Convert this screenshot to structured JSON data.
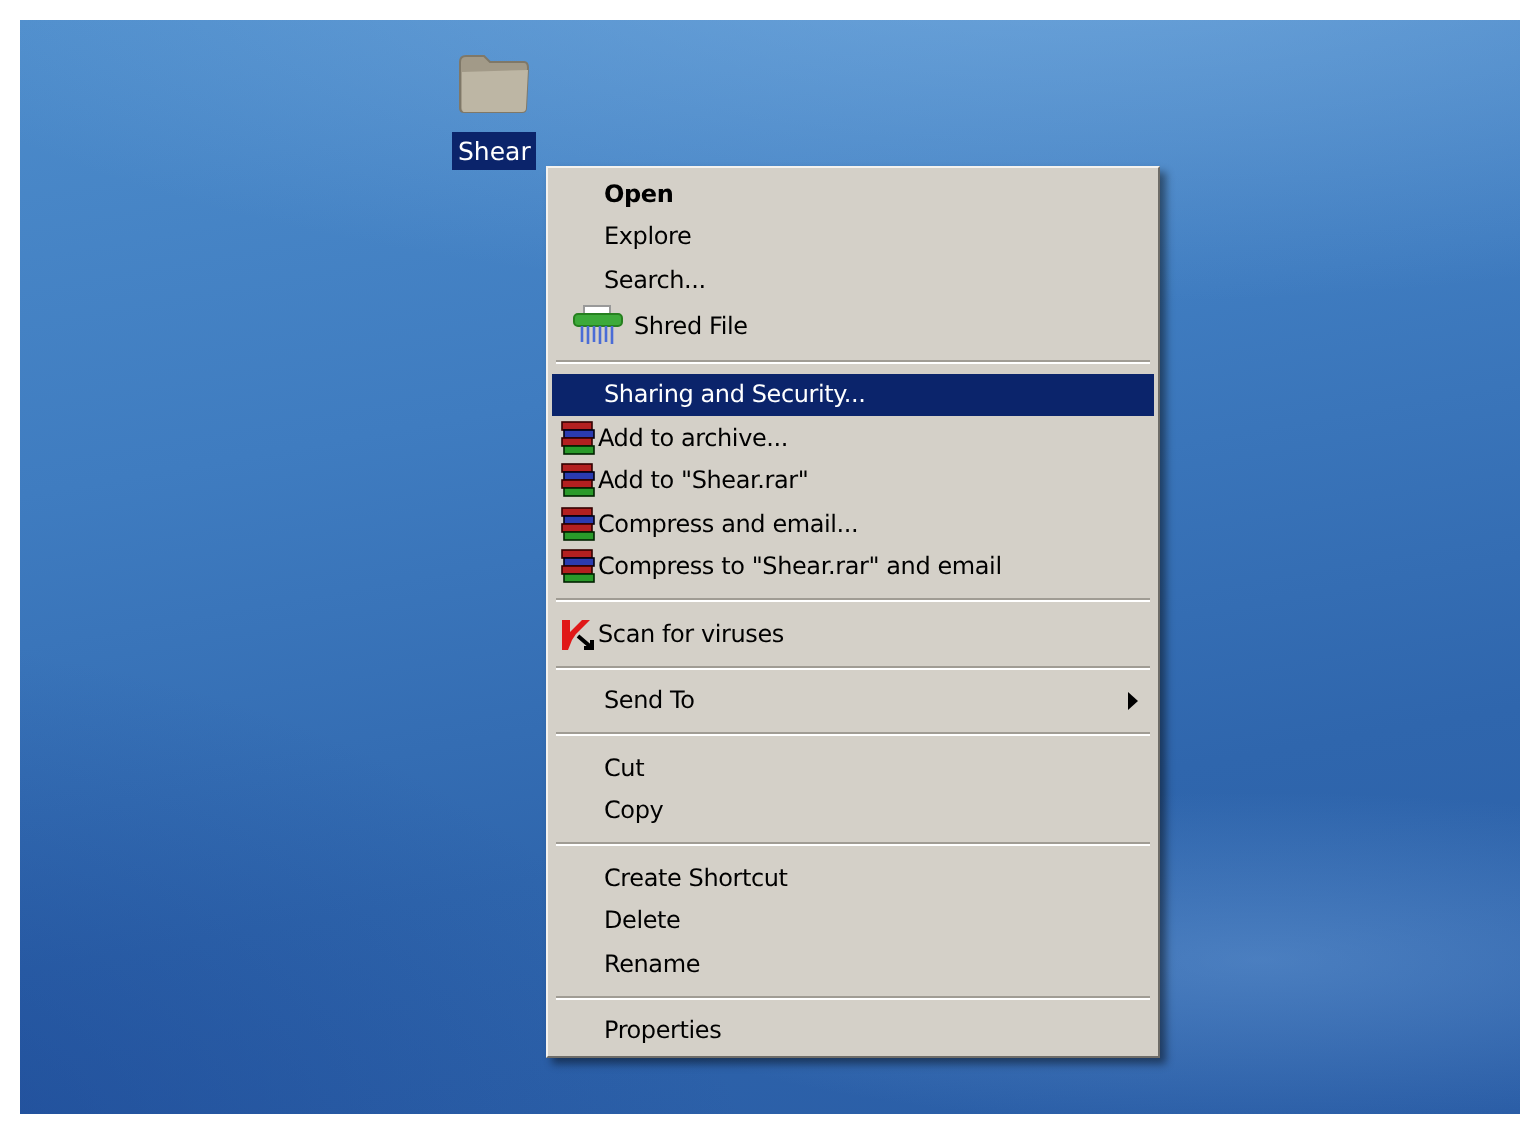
{
  "desktop": {
    "icons": [
      {
        "label": "Shear",
        "selected": true
      }
    ]
  },
  "context_menu": {
    "items": [
      {
        "kind": "item",
        "label": "Open",
        "default": true,
        "selected": false,
        "submenu": false
      },
      {
        "kind": "item",
        "label": "Explore",
        "default": false,
        "selected": false,
        "submenu": false
      },
      {
        "kind": "item",
        "label": "Search...",
        "default": false,
        "selected": false,
        "submenu": false
      },
      {
        "kind": "shred",
        "label": "Shred File",
        "default": false,
        "selected": false,
        "submenu": false
      },
      {
        "kind": "separator"
      },
      {
        "kind": "item",
        "label": "Sharing and Security...",
        "default": false,
        "selected": true,
        "submenu": false
      },
      {
        "kind": "archive",
        "label": "Add to archive...",
        "default": false,
        "selected": false,
        "submenu": false
      },
      {
        "kind": "archive",
        "label": "Add to \"Shear.rar\"",
        "default": false,
        "selected": false,
        "submenu": false
      },
      {
        "kind": "archive",
        "label": "Compress and email...",
        "default": false,
        "selected": false,
        "submenu": false
      },
      {
        "kind": "archive",
        "label": "Compress to \"Shear.rar\" and email",
        "default": false,
        "selected": false,
        "submenu": false
      },
      {
        "kind": "separator"
      },
      {
        "kind": "scan",
        "label": "Scan for viruses",
        "default": false,
        "selected": false,
        "submenu": false
      },
      {
        "kind": "separator"
      },
      {
        "kind": "item",
        "label": "Send To",
        "default": false,
        "selected": false,
        "submenu": true
      },
      {
        "kind": "separator"
      },
      {
        "kind": "item",
        "label": "Cut",
        "default": false,
        "selected": false,
        "submenu": false
      },
      {
        "kind": "item",
        "label": "Copy",
        "default": false,
        "selected": false,
        "submenu": false
      },
      {
        "kind": "separator"
      },
      {
        "kind": "item",
        "label": "Create Shortcut",
        "default": false,
        "selected": false,
        "submenu": false
      },
      {
        "kind": "item",
        "label": "Delete",
        "default": false,
        "selected": false,
        "submenu": false
      },
      {
        "kind": "item",
        "label": "Rename",
        "default": false,
        "selected": false,
        "submenu": false
      },
      {
        "kind": "separator"
      },
      {
        "kind": "item",
        "label": "Properties",
        "default": false,
        "selected": false,
        "submenu": false
      }
    ]
  }
}
